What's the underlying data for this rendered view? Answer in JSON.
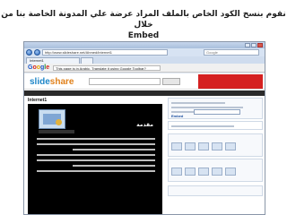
{
  "caption": {
    "line1": "نقوم بنسخ الكود الخاص بالملف المراد عرضة علي المدونة الخاصة بنا من خلال",
    "line2": "Embed"
  },
  "browser": {
    "address": "http://www.slideshare.net/Ahmed/internet1",
    "search_placeholder": "Google",
    "tab_label": "Internet1",
    "tab_new": ""
  },
  "google_bar": {
    "logo": [
      "G",
      "o",
      "o",
      "g",
      "l",
      "e"
    ],
    "message": "This page is in Arabic. Translate it using Google Toolbar?",
    "info": ""
  },
  "slideshare": {
    "logo_part1": "slide",
    "logo_part2": "share",
    "search_placeholder": "",
    "search_button": "",
    "banner_text": "",
    "slide_title": "Internet1",
    "viewer_title": "مقدمة"
  },
  "sidebar": {
    "embed_label": "Embed",
    "box_c_label": "",
    "box_d_label": "",
    "box_e_label": ""
  },
  "colors": {
    "slideshare_blue": "#1e86c8",
    "slideshare_orange": "#e0801a",
    "banner_red": "#d52121"
  }
}
